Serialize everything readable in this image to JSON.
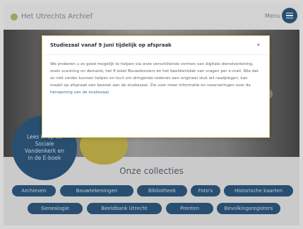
{
  "header": {
    "site_title": "Het Utrechts Archief",
    "menu_label": "Menu"
  },
  "hero": {
    "blue_circle_text": "Lees in op de Sociale Vandenkerk en in de E-boek"
  },
  "collections": {
    "title": "Onze collecties",
    "tags": [
      "Archieven",
      "Bouwtekeningen",
      "Bibliotheek",
      "Foto's",
      "Historische kaarten",
      "Genealogie",
      "Beeldbank Utrecht",
      "Prenten",
      "Bevolkingsregisters"
    ]
  },
  "modal": {
    "title": "Studiezaal vanaf 9 juni tijdelijk op afspraak",
    "close": "×",
    "body": "We proberen u zo goed mogelijk te helpen via onze verschillende vormen van digitale dienstverlening, zoals scanning on demand, het E-loket Bouwdossiers en het beeldenloket van vragen per e-mail. Wie dat zo niet verder kunnen helpen en toch om dringende redenen een origineel stuk wil raadplegen, kan maakt op afspraak een bezoek aan de studiezaal. Zie voor meer informatie en reserveringen over de",
    "link": "heropening van de studiezaal."
  },
  "colors": {
    "primary": "#2e5a82",
    "accent": "#c9b84c",
    "modal_border": "#e2c86a"
  }
}
